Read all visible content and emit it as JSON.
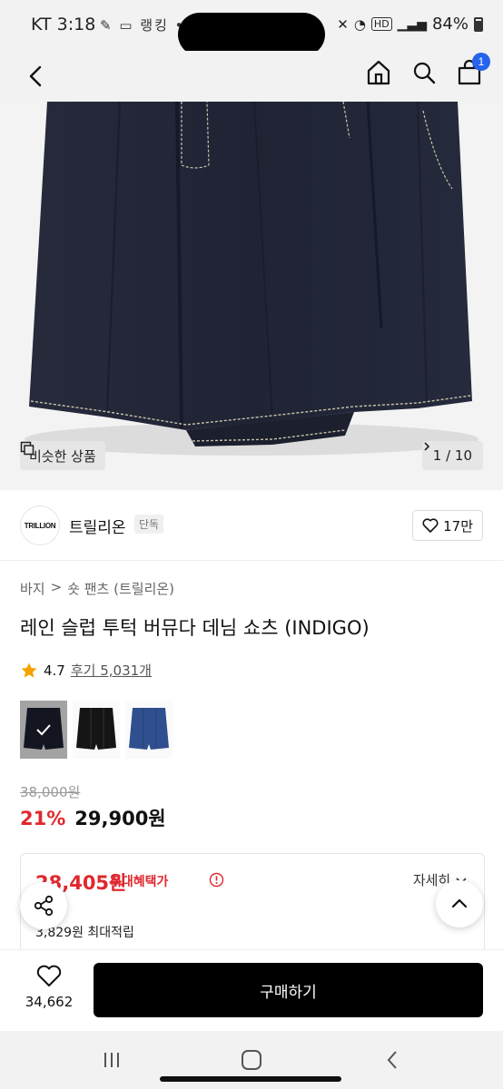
{
  "status_bar": {
    "time": "KT 3:18",
    "left_icons": "✎ ▭ 랭킹 •",
    "battery": "84%",
    "network": "HD"
  },
  "header": {
    "cart_count": "1"
  },
  "gallery": {
    "similar_label": "비슷한 상품",
    "page_indicator": "1 / 10"
  },
  "brand": {
    "logo_text": "TRILLION",
    "name": "트릴리온",
    "tag": "단독",
    "likes": "17만"
  },
  "product": {
    "breadcrumb": [
      "바지",
      ">",
      "숏 팬츠 (트릴리온)"
    ],
    "title": "레인 슬럽 투턱 버뮤다 데님 쇼츠 (INDIGO)",
    "rating": "4.7",
    "reviews": "후기 5,031개",
    "swatches": [
      "indigo",
      "black",
      "blue"
    ],
    "original_price": "38,000원",
    "discount": "21%",
    "price": "29,900원"
  },
  "benefit": {
    "max_price": "28,405원",
    "label": "최대혜택가",
    "detail_link": "자세히",
    "points": "3,829원 최대적립"
  },
  "bottom_bar": {
    "wish_count": "34,662",
    "buy_label": "구매하기"
  },
  "colors": {
    "accent_red": "#e0282e",
    "badge_blue": "#2563eb",
    "denim": "#1e2233"
  }
}
